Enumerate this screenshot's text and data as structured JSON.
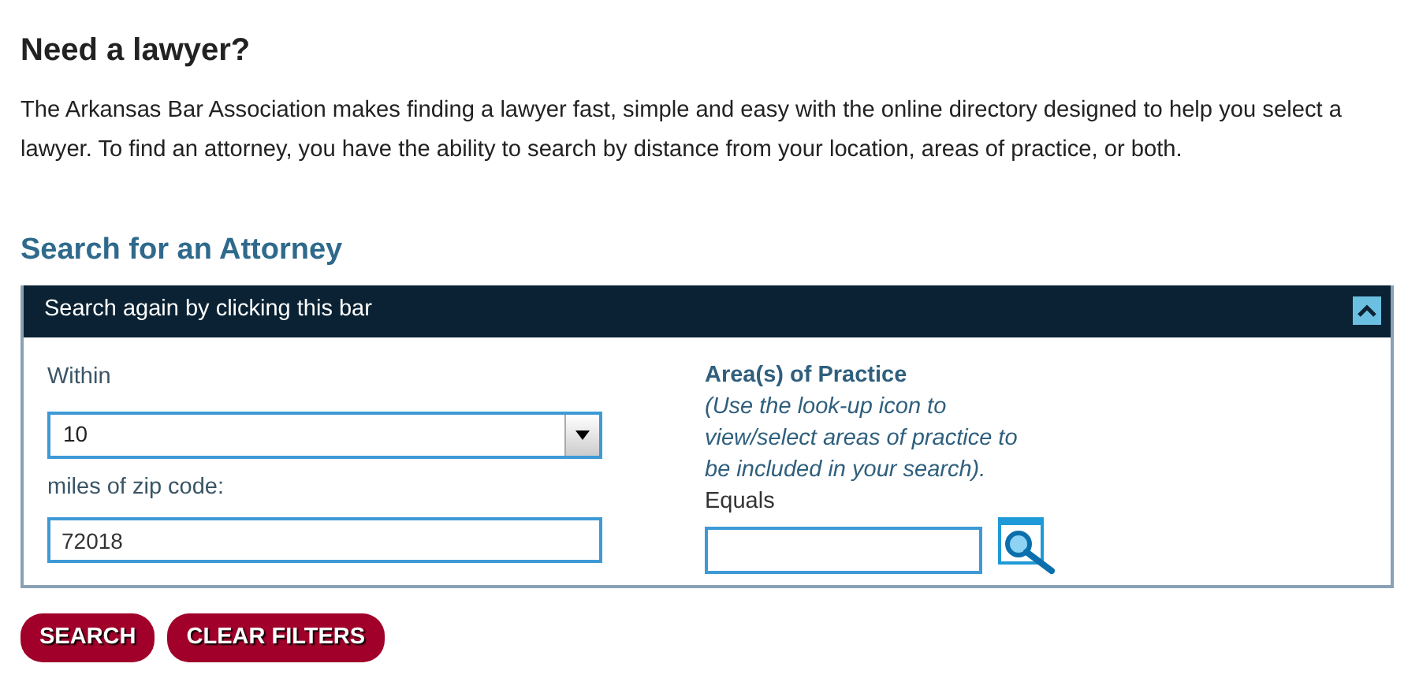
{
  "heading": "Need a lawyer?",
  "intro": "The Arkansas Bar Association makes finding a lawyer fast, simple and easy with the online directory designed to help you select a lawyer.  To find an attorney, you have the ability to search by distance from your location, areas of practice, or both.",
  "search_title": "Search for an Attorney",
  "panel": {
    "bar_label": "Search again by clicking this bar",
    "expanded": true
  },
  "within": {
    "label": "Within",
    "value": "10",
    "suffix_label": "miles of zip code:",
    "zip": "72018"
  },
  "practice": {
    "label": "Area(s) of Practice",
    "hint": "(Use the look-up icon to view/select areas of practice to be included in your search).",
    "equals_label": "Equals"
  },
  "buttons": [
    "SEARCH",
    "CLEAR FILTERS"
  ]
}
